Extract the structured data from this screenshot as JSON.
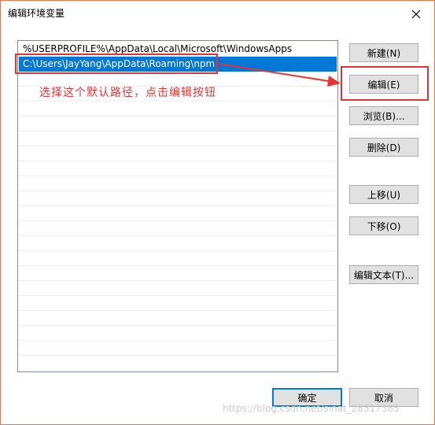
{
  "dialog": {
    "title": "编辑环境变量",
    "close_icon": "close-icon"
  },
  "list": {
    "items": [
      {
        "value": "%USERPROFILE%\\AppData\\Local\\Microsoft\\WindowsApps",
        "selected": false
      },
      {
        "value": "C:\\Users\\JayYang\\AppData\\Roaming\\npm",
        "selected": true
      }
    ]
  },
  "buttons": {
    "new": "新建(N)",
    "edit": "编辑(E)",
    "browse": "浏览(B)...",
    "delete": "删除(D)",
    "move_up": "上移(U)",
    "move_down": "下移(O)",
    "edit_text": "编辑文本(T)...",
    "ok": "确定",
    "cancel": "取消"
  },
  "annotation": {
    "text": "选择这个默认路径，点击编辑按钮",
    "color": "#e53333"
  },
  "watermark": "https://blog.csdn.net/sinat_28317385",
  "colors": {
    "selection": "#0078d7",
    "window_border": "#e8744c"
  }
}
